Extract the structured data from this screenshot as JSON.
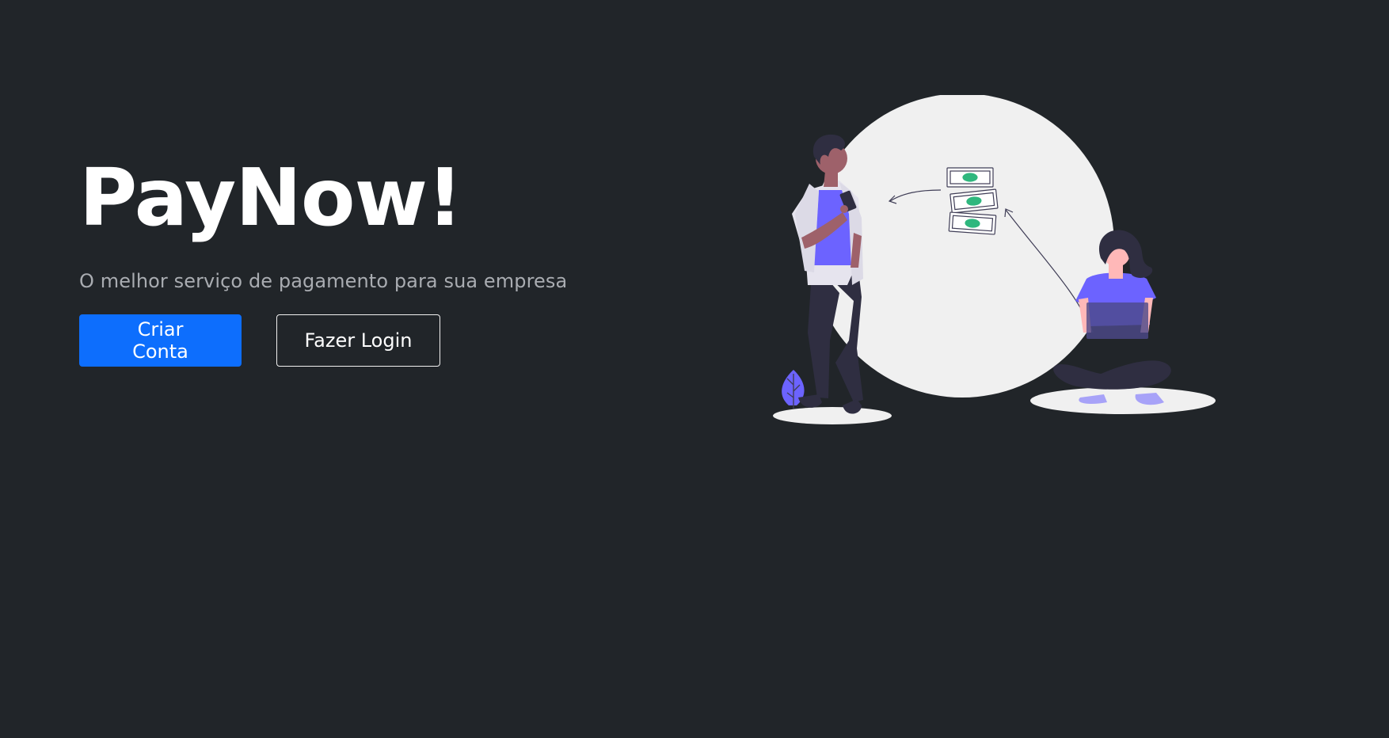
{
  "hero": {
    "title": "PayNow!",
    "subtitle": "O melhor serviço de pagamento para sua empresa"
  },
  "actions": {
    "primary_label": "Criar Conta",
    "secondary_label": "Fazer Login"
  },
  "illustration": {
    "name": "payment-illustration",
    "icons": [
      "man-with-phone",
      "woman-with-laptop",
      "money-bills",
      "leaf-plant"
    ]
  },
  "colors": {
    "background": "#212529",
    "primary": "#0d6efd",
    "accent": "#6c63ff",
    "subtitle": "#a9acb1"
  }
}
